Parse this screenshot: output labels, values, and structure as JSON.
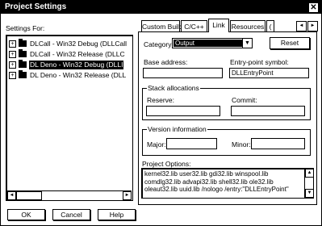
{
  "window": {
    "title": "Project Settings",
    "close_glyph": "✕"
  },
  "settings_for": {
    "label": "Settings For:"
  },
  "tree": {
    "items": [
      {
        "label": "DLCall - Win32 Debug (DLLCall",
        "selected": false
      },
      {
        "label": "DLCall - Win32 Release (DLLC",
        "selected": false
      },
      {
        "label": "DL Deno - Win32 Debug (DLLI",
        "selected": true
      },
      {
        "label": "DL Deno - Win32 Release (DLL",
        "selected": false
      }
    ],
    "expand_glyph": "+"
  },
  "tabs": [
    {
      "label": "Custom Build"
    },
    {
      "label": "C/C++"
    },
    {
      "label": "Link"
    },
    {
      "label": "Resources"
    },
    {
      "label": "("
    }
  ],
  "tab_nav": {
    "left": "◄",
    "right": "►"
  },
  "link_tab": {
    "category_label": "Category:",
    "category_value": "Output",
    "reset_label": "Reset",
    "base_address_label": "Base address:",
    "base_address_value": "",
    "entry_point_label": "Entry-point symbol:",
    "entry_point_value": "DLLEntryPoint",
    "stack_group_label": "Stack allocations",
    "reserve_label": "Reserve:",
    "reserve_value": "",
    "commit_label": "Commit:",
    "commit_value": "",
    "version_group_label": "Version information",
    "major_label": "Major:",
    "major_value": "",
    "minor_label": "Minor:",
    "minor_value": "",
    "project_options_label": "Project Options:",
    "project_options_text": "kernel32.lib user32.lib gdi32.lib winspool.lib\ncomdlg32.lib advapi32.lib shell32.lib ole32.lib\noleaut32.lib uuid.lib /nologo /entry:\"DLLEntryPoint\""
  },
  "buttons": {
    "ok": "OK",
    "cancel": "Cancel",
    "help": "Help"
  }
}
